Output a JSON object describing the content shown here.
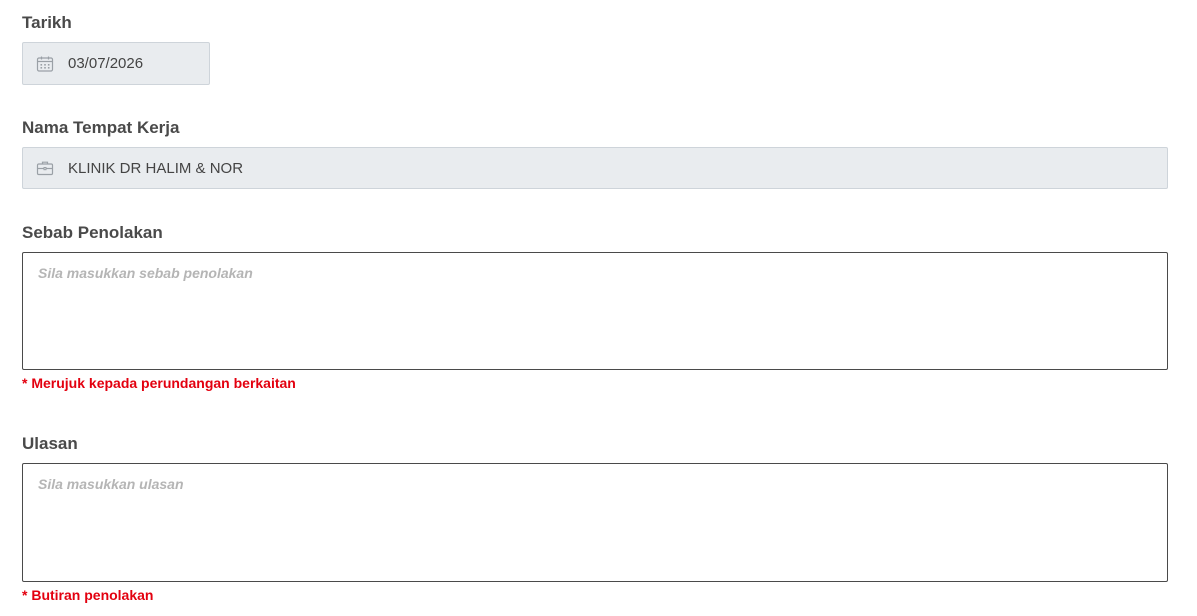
{
  "date": {
    "label": "Tarikh",
    "value": "03/07/2026",
    "icon": "calendar-icon"
  },
  "workplace": {
    "label": "Nama Tempat Kerja",
    "value": "KLINIK DR HALIM & NOR",
    "icon": "briefcase-icon"
  },
  "rejection_reason": {
    "label": "Sebab Penolakan",
    "placeholder": "Sila masukkan sebab penolakan",
    "value": "",
    "hint": "* Merujuk kepada perundangan berkaitan"
  },
  "review": {
    "label": "Ulasan",
    "placeholder": "Sila masukkan ulasan",
    "value": "",
    "hint": "* Butiran penolakan"
  },
  "colors": {
    "hint": "#e3000f",
    "readonly_bg": "#e9ecef",
    "label": "#4a4a4a"
  }
}
